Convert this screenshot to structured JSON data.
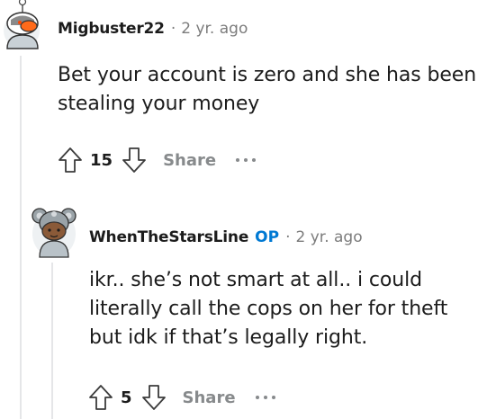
{
  "comments": [
    {
      "author": "Migbuster22",
      "op_badge": "",
      "separator": "·",
      "time": "2 yr. ago",
      "lines": [
        "Bet your account is zero and she has been",
        "stealing your money"
      ],
      "score": "15",
      "share_label": "Share"
    },
    {
      "author": "WhenTheStarsLine",
      "op_badge": "OP",
      "separator": "·",
      "time": "2 yr. ago",
      "lines": [
        "ikr.. she’s not smart at all.. i could",
        "literally call the cops on her for theft",
        "but idk if that’s legally right."
      ],
      "score": "5",
      "share_label": "Share"
    }
  ],
  "icons": {
    "upvote": "arrow-up-outline-icon",
    "downvote": "arrow-down-outline-icon",
    "more": "ellipsis-icon"
  },
  "colors": {
    "op": "#0079d3",
    "muted": "#7c7c7c",
    "thread_line": "#e5e6e8"
  }
}
